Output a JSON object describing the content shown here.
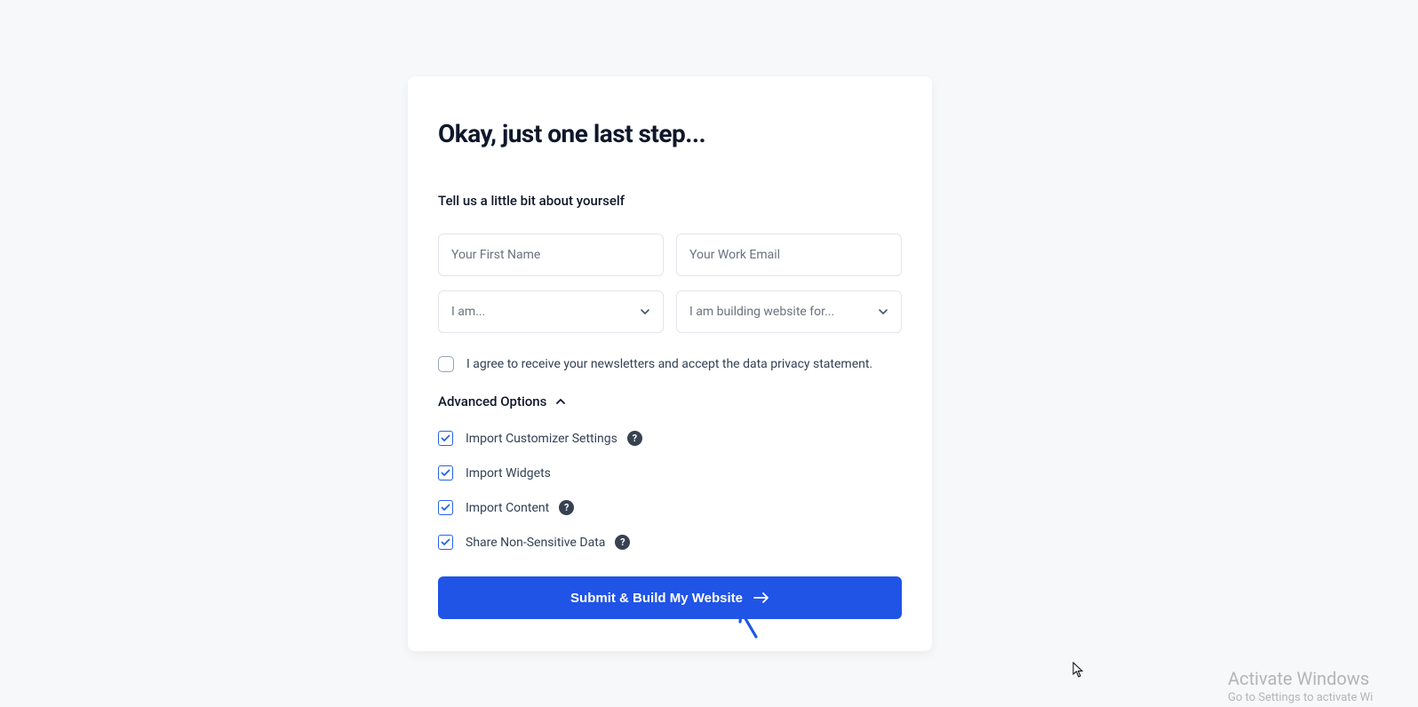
{
  "card": {
    "title": "Okay, just one last step...",
    "subtitle": "Tell us a little bit about yourself",
    "first_name_placeholder": "Your First Name",
    "email_placeholder": "Your Work Email",
    "role_select": "I am...",
    "building_select": "I am building website for...",
    "consent_text": "I agree to receive your newsletters and accept the data privacy statement.",
    "advanced_label": "Advanced Options",
    "options": [
      {
        "label": "Import Customizer Settings",
        "help": true
      },
      {
        "label": "Import Widgets",
        "help": false
      },
      {
        "label": "Import Content",
        "help": true
      },
      {
        "label": "Share Non-Sensitive Data",
        "help": true
      }
    ],
    "submit_label": "Submit & Build My Website"
  },
  "watermark": {
    "title": "Activate Windows",
    "sub": "Go to Settings to activate Wi"
  }
}
